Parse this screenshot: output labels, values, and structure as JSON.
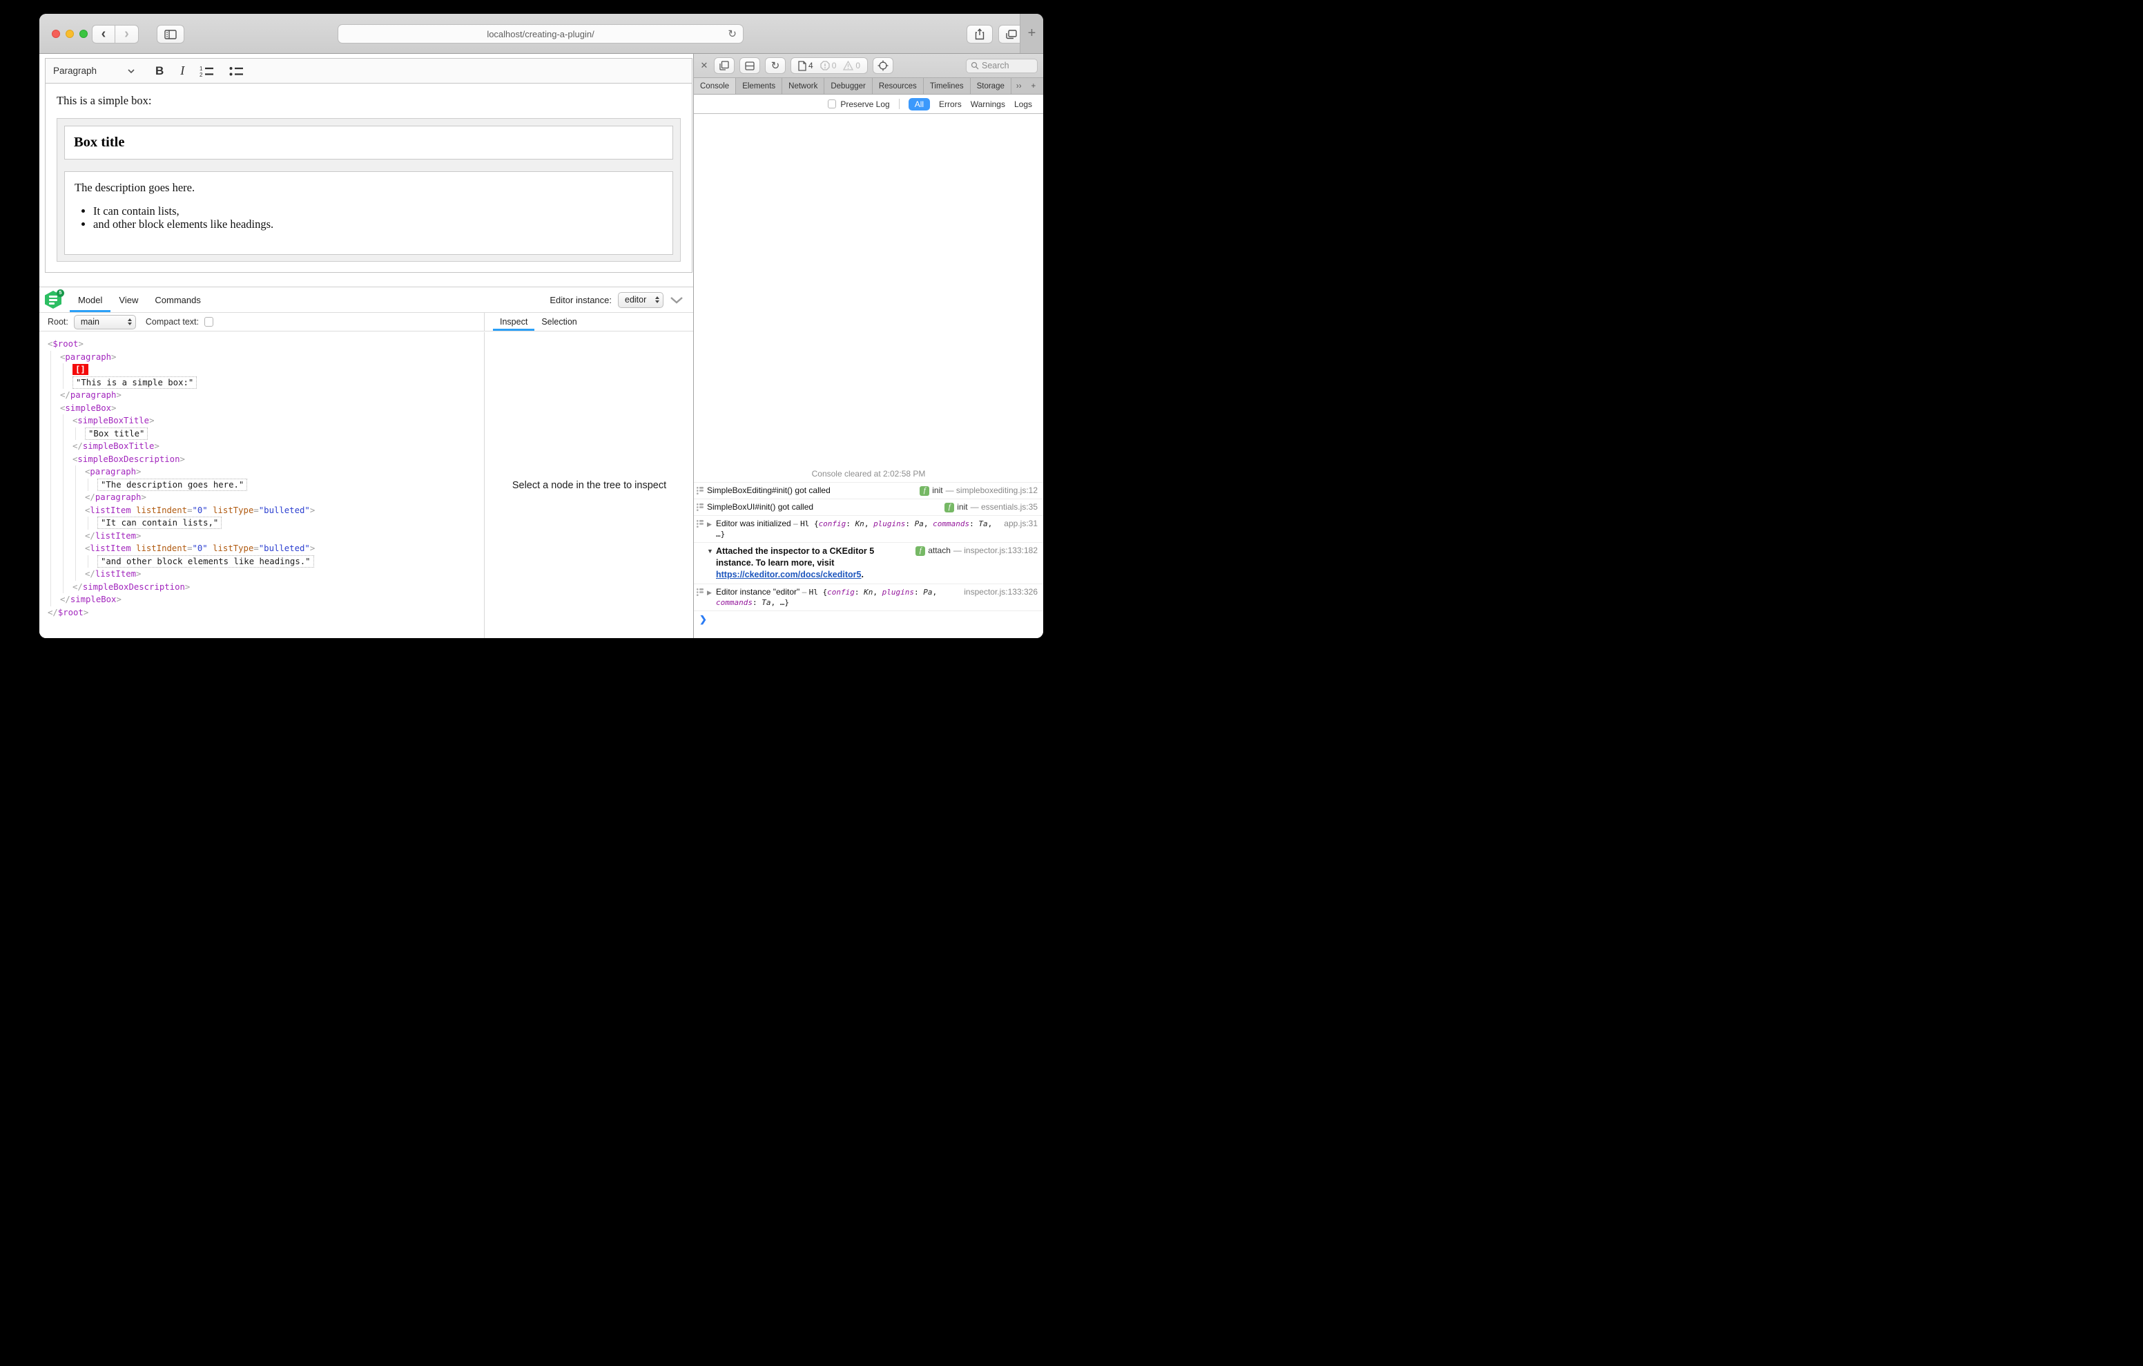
{
  "browser": {
    "address": "localhost/creating-a-plugin/",
    "icons": {
      "back": "‹",
      "forward": "›",
      "reload": "↻",
      "new_tab": "+"
    }
  },
  "editor": {
    "toolbar": {
      "style_dropdown": "Paragraph",
      "bold": "B",
      "italic": "I"
    },
    "content": {
      "intro": "This is a simple box:",
      "box_title": "Box title",
      "description": "The description goes here.",
      "list_items": [
        "It can contain lists,",
        "and other block elements like headings."
      ]
    }
  },
  "inspector": {
    "tabs": [
      {
        "label": "Model",
        "active": true
      },
      {
        "label": "View",
        "active": false
      },
      {
        "label": "Commands",
        "active": false
      }
    ],
    "editor_instance": {
      "label": "Editor instance:",
      "value": "editor"
    },
    "root": {
      "label": "Root:",
      "value": "main"
    },
    "compact_text_label": "Compact text:",
    "pane_tabs": [
      {
        "label": "Inspect",
        "active": true
      },
      {
        "label": "Selection",
        "active": false
      }
    ],
    "empty_message": "Select a node in the tree to inspect",
    "tree": [
      {
        "level": 0,
        "kind": "open",
        "tag": "$root"
      },
      {
        "level": 1,
        "kind": "open",
        "tag": "paragraph"
      },
      {
        "level": 2,
        "kind": "selection",
        "text": "[]"
      },
      {
        "level": 2,
        "kind": "text",
        "text": "\"This is a simple box:\""
      },
      {
        "level": 1,
        "kind": "close",
        "tag": "paragraph"
      },
      {
        "level": 1,
        "kind": "open",
        "tag": "simpleBox"
      },
      {
        "level": 2,
        "kind": "open",
        "tag": "simpleBoxTitle"
      },
      {
        "level": 3,
        "kind": "text",
        "text": "\"Box title\""
      },
      {
        "level": 2,
        "kind": "close",
        "tag": "simpleBoxTitle"
      },
      {
        "level": 2,
        "kind": "open",
        "tag": "simpleBoxDescription"
      },
      {
        "level": 3,
        "kind": "open",
        "tag": "paragraph"
      },
      {
        "level": 4,
        "kind": "text",
        "text": "\"The description goes here.\""
      },
      {
        "level": 3,
        "kind": "close",
        "tag": "paragraph"
      },
      {
        "level": 3,
        "kind": "open",
        "tag": "listItem",
        "attrs": [
          {
            "name": "listIndent",
            "value": "\"0\""
          },
          {
            "name": "listType",
            "value": "\"bulleted\""
          }
        ]
      },
      {
        "level": 4,
        "kind": "text",
        "text": "\"It can contain lists,\""
      },
      {
        "level": 3,
        "kind": "close",
        "tag": "listItem"
      },
      {
        "level": 3,
        "kind": "open",
        "tag": "listItem",
        "attrs": [
          {
            "name": "listIndent",
            "value": "\"0\""
          },
          {
            "name": "listType",
            "value": "\"bulleted\""
          }
        ]
      },
      {
        "level": 4,
        "kind": "text",
        "text": "\"and other block elements like headings.\""
      },
      {
        "level": 3,
        "kind": "close",
        "tag": "listItem"
      },
      {
        "level": 2,
        "kind": "close",
        "tag": "simpleBoxDescription"
      },
      {
        "level": 1,
        "kind": "close",
        "tag": "simpleBox"
      },
      {
        "level": 0,
        "kind": "close",
        "tag": "$root"
      }
    ]
  },
  "devtools": {
    "toolbar": {
      "resource_count": "4",
      "error_count": "0",
      "warning_count": "0",
      "search_placeholder": "Search"
    },
    "icons": {
      "close": "✕",
      "settings": "⚙",
      "overflow": "››",
      "add_tab": "+",
      "reload": "↻"
    },
    "tabs": [
      {
        "label": "Console",
        "active": true
      },
      {
        "label": "Elements",
        "active": false
      },
      {
        "label": "Network",
        "active": false
      },
      {
        "label": "Debugger",
        "active": false
      },
      {
        "label": "Resources",
        "active": false
      },
      {
        "label": "Timelines",
        "active": false
      },
      {
        "label": "Storage",
        "active": false
      }
    ],
    "filter": {
      "preserve_log": "Preserve Log",
      "levels": [
        {
          "label": "All",
          "active": true
        },
        {
          "label": "Errors",
          "active": false
        },
        {
          "label": "Warnings",
          "active": false
        },
        {
          "label": "Logs",
          "active": false
        }
      ]
    },
    "console": {
      "cleared": "Console cleared at 2:02:58 PM",
      "rows": [
        {
          "icon": "stack",
          "text": "SimpleBoxEditing#init() got called",
          "badge": "init",
          "source": "simpleboxediting.js:12"
        },
        {
          "icon": "stack",
          "text": "SimpleBoxUI#init() got called",
          "badge": "init",
          "source": "essentials.js:35"
        },
        {
          "icon": "stack",
          "disclosure": "closed",
          "text": "Editor was initialized",
          "preview": [
            [
              "dim",
              " – "
            ],
            [
              "mono",
              "Hl "
            ],
            [
              "mono",
              "{"
            ],
            [
              "key",
              "config"
            ],
            [
              "mono",
              ": "
            ],
            [
              "val",
              "Kn"
            ],
            [
              "mono",
              ", "
            ],
            [
              "key",
              "plugins"
            ],
            [
              "mono",
              ": "
            ],
            [
              "val",
              "Pa"
            ],
            [
              "mono",
              ", "
            ],
            [
              "key",
              "commands"
            ],
            [
              "mono",
              ": "
            ],
            [
              "val",
              "Ta"
            ],
            [
              "mono",
              ", …}"
            ]
          ],
          "source": "app.js:31"
        },
        {
          "disclosure": "open",
          "bold": true,
          "text": "Attached the inspector to a CKEditor 5 instance. To learn more, visit ",
          "link": "https://ckeditor.com/docs/ckeditor5",
          "suffix": ".",
          "badge": "attach",
          "source": "inspector.js:133:182"
        },
        {
          "icon": "stack",
          "disclosure": "closed",
          "text": "Editor instance \"editor\"",
          "preview": [
            [
              "dim",
              " – "
            ],
            [
              "mono",
              "Hl "
            ],
            [
              "mono",
              "{"
            ],
            [
              "key",
              "config"
            ],
            [
              "mono",
              ": "
            ],
            [
              "val",
              "Kn"
            ],
            [
              "mono",
              ", "
            ],
            [
              "key",
              "plugins"
            ],
            [
              "mono",
              ": "
            ],
            [
              "val",
              "Pa"
            ],
            [
              "mono",
              ", "
            ],
            [
              "key",
              "commands"
            ],
            [
              "mono",
              ": "
            ],
            [
              "val",
              "Ta"
            ],
            [
              "mono",
              ", …}"
            ]
          ],
          "source": "inspector.js:133:326"
        }
      ],
      "prompt": "❯"
    }
  },
  "colors": {
    "accent_blue": "#3b99fc",
    "tab_underline": "#2ba0f7",
    "tag_purple": "#a226bd",
    "attr_orange": "#b05a10",
    "attr_value_blue": "#2b3fd0",
    "selection_red": "#f40b0b",
    "badge_green": "#76b865",
    "logo_green": "#2cbe62"
  }
}
